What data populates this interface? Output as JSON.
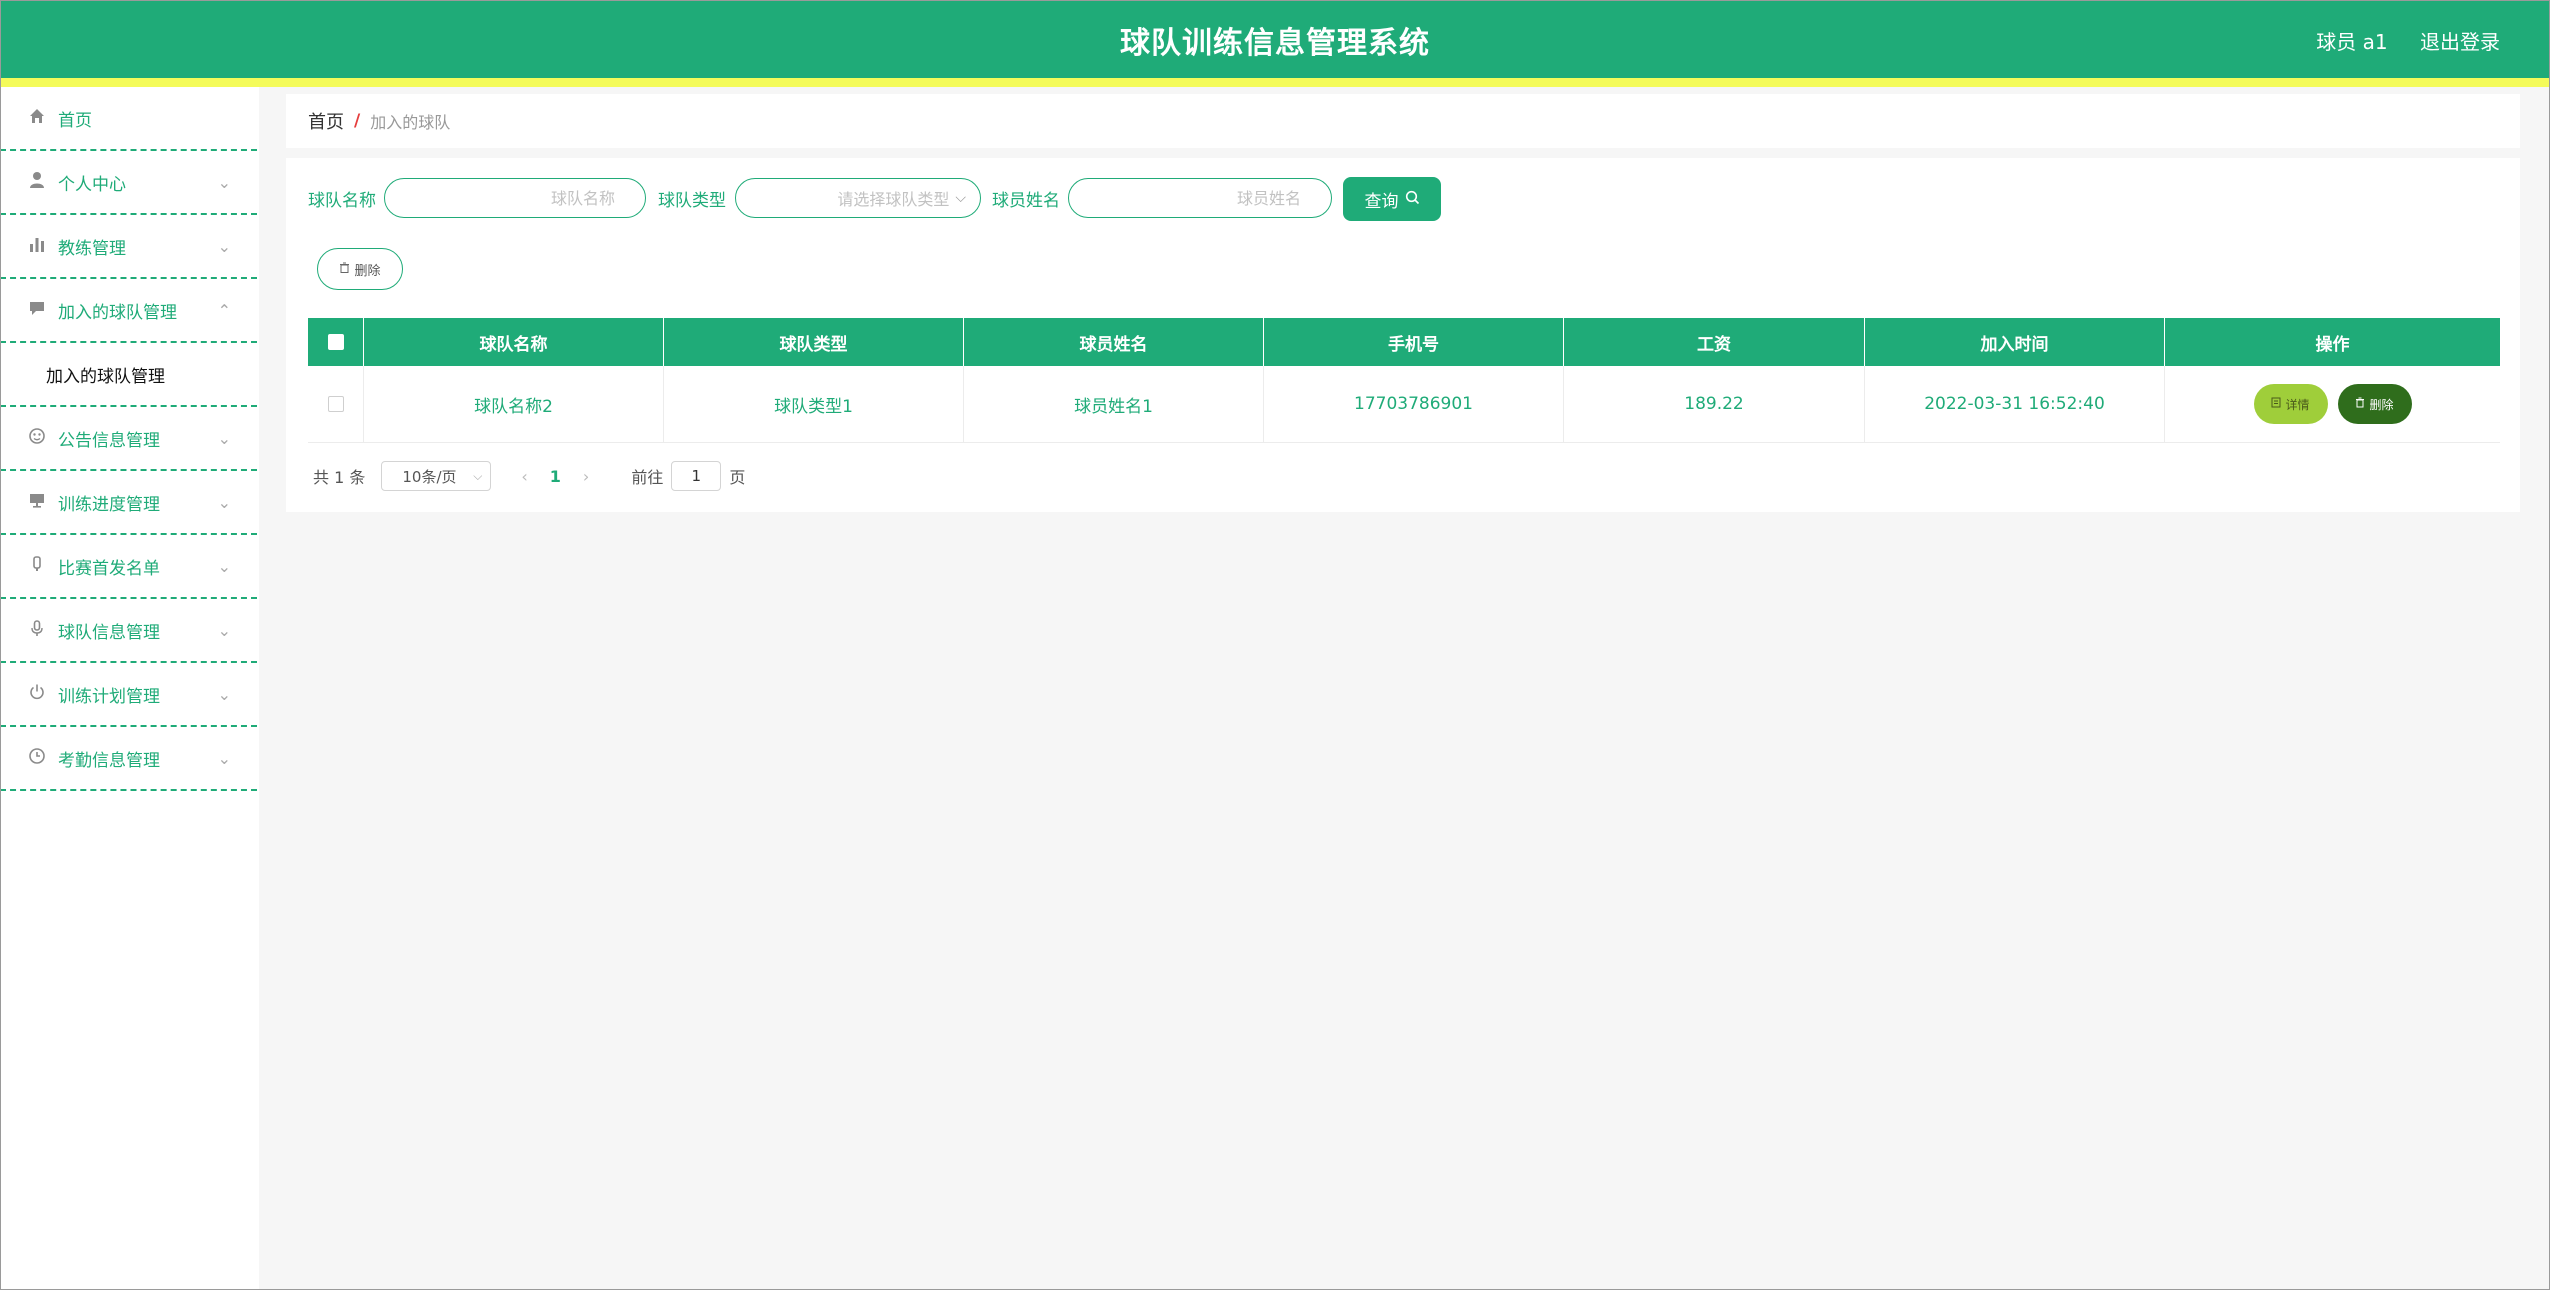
{
  "header": {
    "title": "球队训练信息管理系统",
    "user": "球员 a1",
    "logout": "退出登录"
  },
  "sidebar": {
    "items": [
      {
        "label": "首页",
        "icon": "home-icon",
        "arrow": ""
      },
      {
        "label": "个人中心",
        "icon": "user-icon",
        "arrow": "⌄"
      },
      {
        "label": "教练管理",
        "icon": "chart-icon",
        "arrow": "⌄"
      },
      {
        "label": "加入的球队管理",
        "icon": "chat-icon",
        "arrow": "⌃"
      },
      {
        "label": "公告信息管理",
        "icon": "globe-icon",
        "arrow": "⌄"
      },
      {
        "label": "训练进度管理",
        "icon": "monitor-icon",
        "arrow": "⌄"
      },
      {
        "label": "比赛首发名单",
        "icon": "bottle-icon",
        "arrow": "⌄"
      },
      {
        "label": "球队信息管理",
        "icon": "microphone-icon",
        "arrow": "⌄"
      },
      {
        "label": "训练计划管理",
        "icon": "power-icon",
        "arrow": "⌄"
      },
      {
        "label": "考勤信息管理",
        "icon": "clock-icon",
        "arrow": "⌄"
      }
    ],
    "submenu_label": "加入的球队管理"
  },
  "breadcrumb": {
    "home": "首页",
    "separator": "/",
    "current": "加入的球队"
  },
  "search": {
    "team_name_label": "球队名称",
    "team_name_placeholder": "球队名称",
    "team_type_label": "球队类型",
    "team_type_placeholder": "请选择球队类型",
    "player_name_label": "球员姓名",
    "player_name_placeholder": "球员姓名",
    "query_button": "查询"
  },
  "actions": {
    "delete_label": "删除"
  },
  "table": {
    "columns": [
      "球队名称",
      "球队类型",
      "球员姓名",
      "手机号",
      "工资",
      "加入时间",
      "操作"
    ],
    "rows": [
      {
        "team_name": "球队名称2",
        "team_type": "球队类型1",
        "player_name": "球员姓名1",
        "phone": "17703786901",
        "salary": "189.22",
        "join_time": "2022-03-31 16:52:40",
        "detail_label": "详情",
        "delete_label": "删除"
      }
    ]
  },
  "pagination": {
    "total": "共 1 条",
    "page_size": "10条/页",
    "current_page": "1",
    "goto_label": "前往",
    "goto_value": "1",
    "page_unit": "页"
  },
  "colors": {
    "primary": "#1fab78",
    "accent_strip": "#f4fb5a",
    "detail_button": "#9fce3a",
    "delete_button": "#2f6d1c"
  }
}
